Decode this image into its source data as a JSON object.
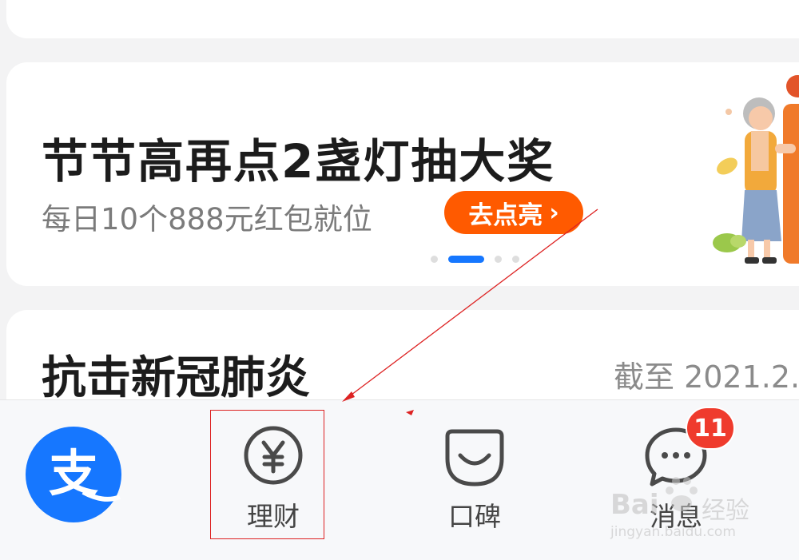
{
  "promo": {
    "title": "节节高再点2盏灯抽大奖",
    "subtitle": "每日10个888元红包就位",
    "button_label": "去点亮",
    "button_chevron": "›"
  },
  "covid": {
    "title": "抗击新冠肺炎",
    "date": "截至 2021.2."
  },
  "tabbar": {
    "items": [
      {
        "label": "支",
        "icon": "alipay-logo"
      },
      {
        "label": "理财",
        "icon": "yuan-circle-icon"
      },
      {
        "label": "口碑",
        "icon": "koubei-smile-icon"
      },
      {
        "label": "消息",
        "icon": "chat-bubble-icon",
        "badge": "11"
      }
    ]
  },
  "watermark": {
    "brand": "Bai",
    "brand2": "经验",
    "url": "jingyan.baidu.com"
  },
  "colors": {
    "accent_blue": "#1677ff",
    "promo_orange": "#ff5a00",
    "badge_red": "#ef3b2d",
    "annotation_red": "#d22222"
  }
}
